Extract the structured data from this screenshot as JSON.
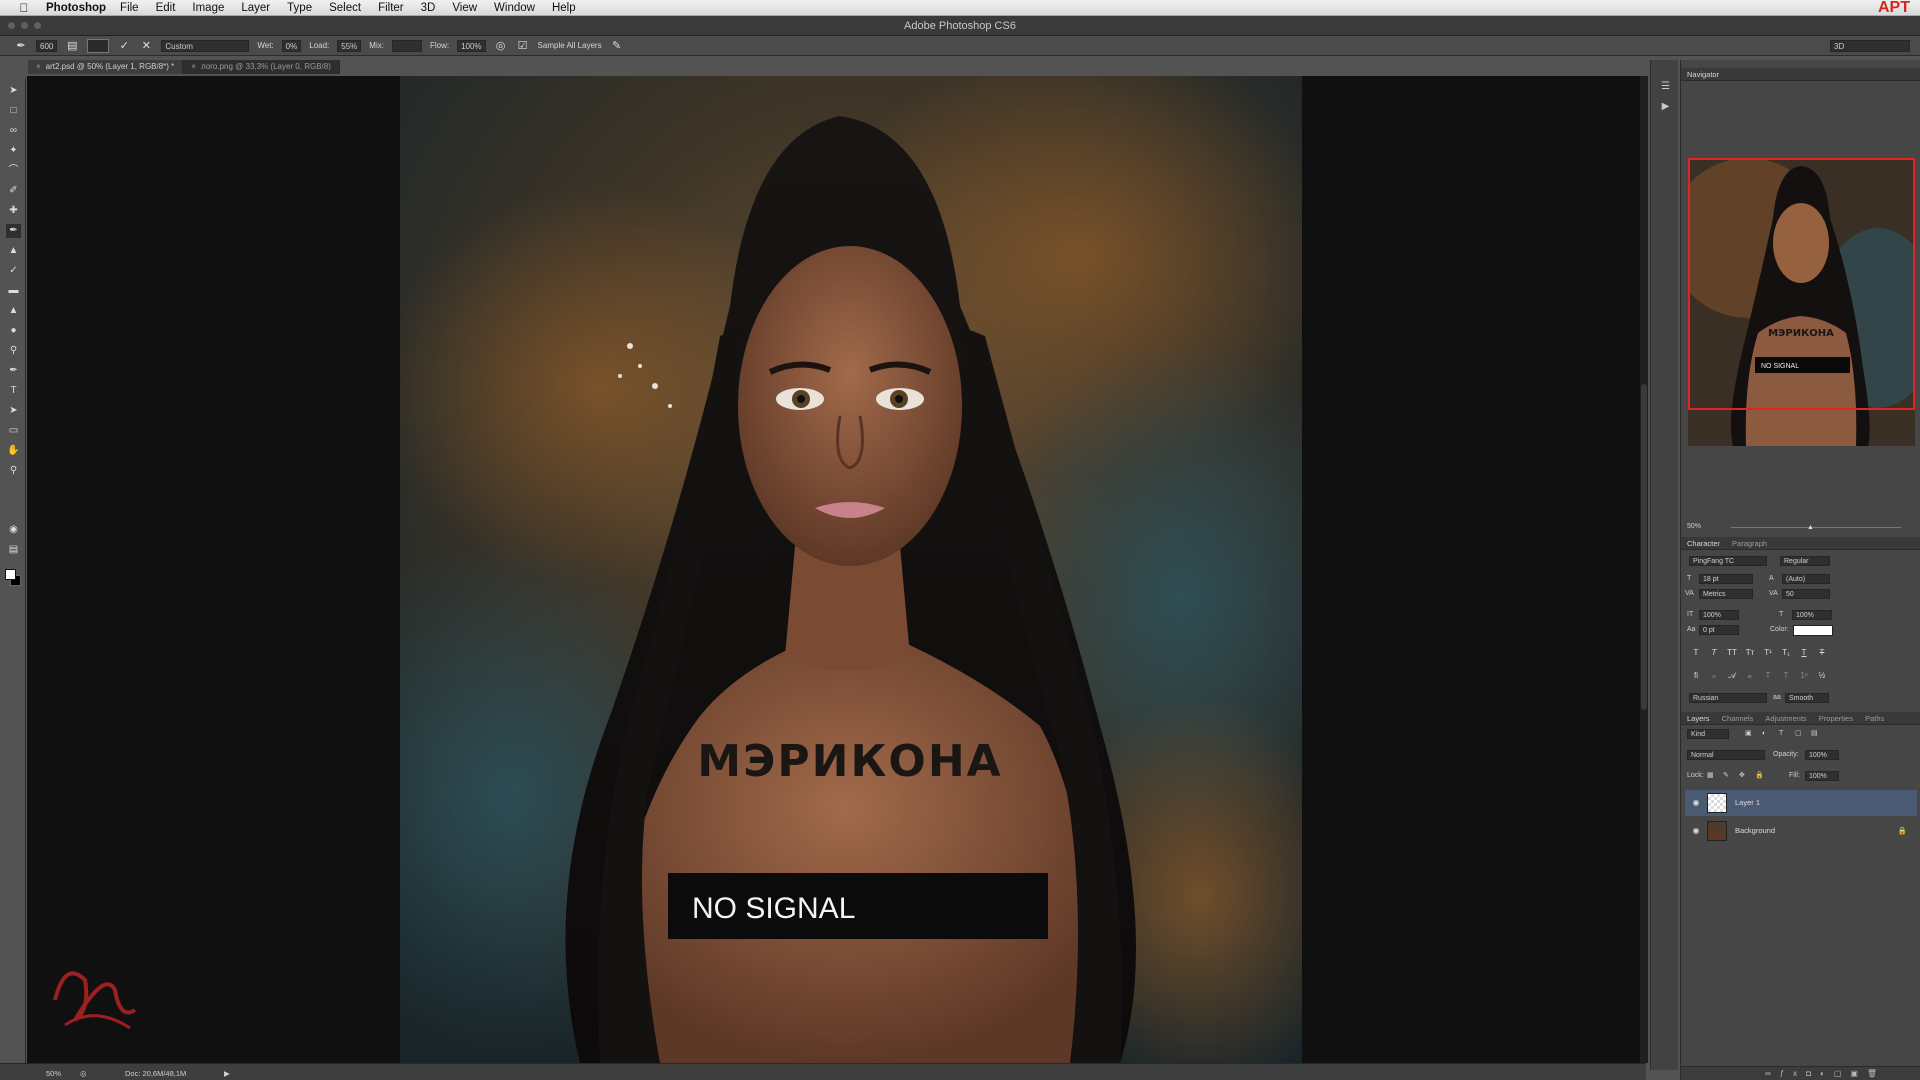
{
  "menubar": {
    "app_name": "Photoshop",
    "items": [
      "File",
      "Edit",
      "Image",
      "Layer",
      "Type",
      "Select",
      "Filter",
      "3D",
      "View",
      "Window",
      "Help"
    ],
    "right_badge": "APT"
  },
  "window": {
    "title": "Adobe Photoshop CS6"
  },
  "options_bar": {
    "brush_size": "600",
    "preset": "Custom",
    "wet_label": "Wet:",
    "wet_value": "0%",
    "load_label": "Load:",
    "load_value": "55%",
    "mix_label": "Mix:",
    "mix_value": "",
    "flow_label": "Flow:",
    "flow_value": "100%",
    "sample_all_layers": "Sample All Layers",
    "workspace": "3D"
  },
  "document_tabs": [
    {
      "label": "art2.psd @ 50% (Layer 1, RGB/8*) *",
      "active": true
    },
    {
      "label": "лого.png @ 33,3% (Layer 0, RGB/8)",
      "active": false
    }
  ],
  "artwork": {
    "chest_text": "МЭРИКОНА",
    "overlay_text": "NO SIGNAL",
    "signature": "Max Twain"
  },
  "status": {
    "zoom": "50%",
    "doc": "Doc: 20,6M/48,1M"
  },
  "navigator": {
    "title": "Navigator",
    "zoom": "50%"
  },
  "character": {
    "tabs": [
      "Character",
      "Paragraph"
    ],
    "font_family": "PingFang TC",
    "font_style": "Regular",
    "size": "18 pt",
    "leading": "(Auto)",
    "kerning": "Metrics",
    "tracking": "50",
    "vscale": "100%",
    "hscale": "100%",
    "baseline": "0 pt",
    "color_label": "Color:",
    "language": "Russian",
    "antialias": "Smooth",
    "swatch": "#ffffff"
  },
  "layers_panel": {
    "tabs": [
      "Layers",
      "Channels",
      "Adjustments",
      "Properties",
      "Paths"
    ],
    "filter": "Kind",
    "blend_mode": "Normal",
    "opacity_label": "Opacity:",
    "opacity": "100%",
    "lock_label": "Lock:",
    "fill_label": "Fill:",
    "fill": "100%",
    "layers": [
      {
        "name": "Layer 1",
        "selected": true
      },
      {
        "name": "Background",
        "selected": false,
        "locked": true
      }
    ]
  },
  "colors": {
    "accent_red": "#e02424",
    "selection_blue": "#4b5a73"
  }
}
